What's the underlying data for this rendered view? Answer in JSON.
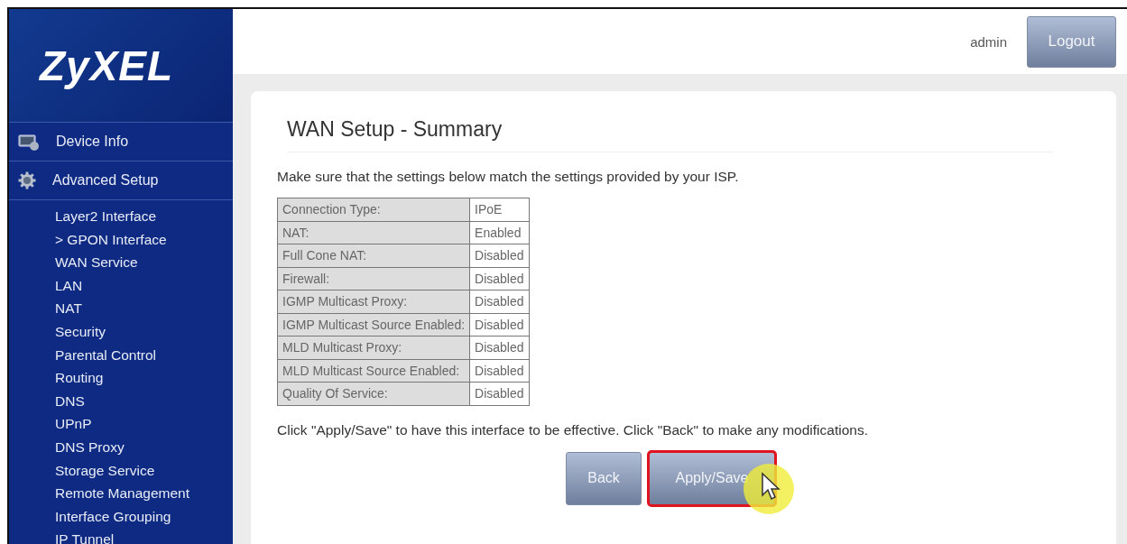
{
  "logo": "ZyXEL",
  "header": {
    "user": "admin",
    "logout": "Logout"
  },
  "sidebar": {
    "sections": [
      {
        "label": "Device Info",
        "kind": "info"
      },
      {
        "label": "Advanced Setup",
        "kind": "setup"
      }
    ],
    "items": [
      "Layer2 Interface",
      "> GPON Interface",
      "WAN Service",
      "LAN",
      "NAT",
      "Security",
      "Parental Control",
      "Routing",
      "DNS",
      "UPnP",
      "DNS Proxy",
      "Storage Service",
      "Remote Management",
      "Interface Grouping",
      "IP Tunnel"
    ]
  },
  "page": {
    "title": "WAN Setup - Summary",
    "intro": "Make sure that the settings below match the settings provided by your ISP.",
    "rows": [
      {
        "label": "Connection Type:",
        "value": "IPoE"
      },
      {
        "label": "NAT:",
        "value": "Enabled"
      },
      {
        "label": "Full Cone NAT:",
        "value": "Disabled"
      },
      {
        "label": "Firewall:",
        "value": "Disabled"
      },
      {
        "label": "IGMP Multicast Proxy:",
        "value": "Disabled"
      },
      {
        "label": "IGMP Multicast Source Enabled:",
        "value": "Disabled"
      },
      {
        "label": "MLD Multicast Proxy:",
        "value": "Disabled"
      },
      {
        "label": "MLD Multicast Source Enabled:",
        "value": "Disabled"
      },
      {
        "label": "Quality Of Service:",
        "value": "Disabled"
      }
    ],
    "note": "Click \"Apply/Save\" to have this interface to be effective. Click \"Back\" to make any modifications.",
    "buttons": [
      {
        "label": "Back",
        "highlighted": false,
        "cursor": false
      },
      {
        "label": "Apply/Save",
        "highlighted": true,
        "cursor": true
      }
    ]
  }
}
